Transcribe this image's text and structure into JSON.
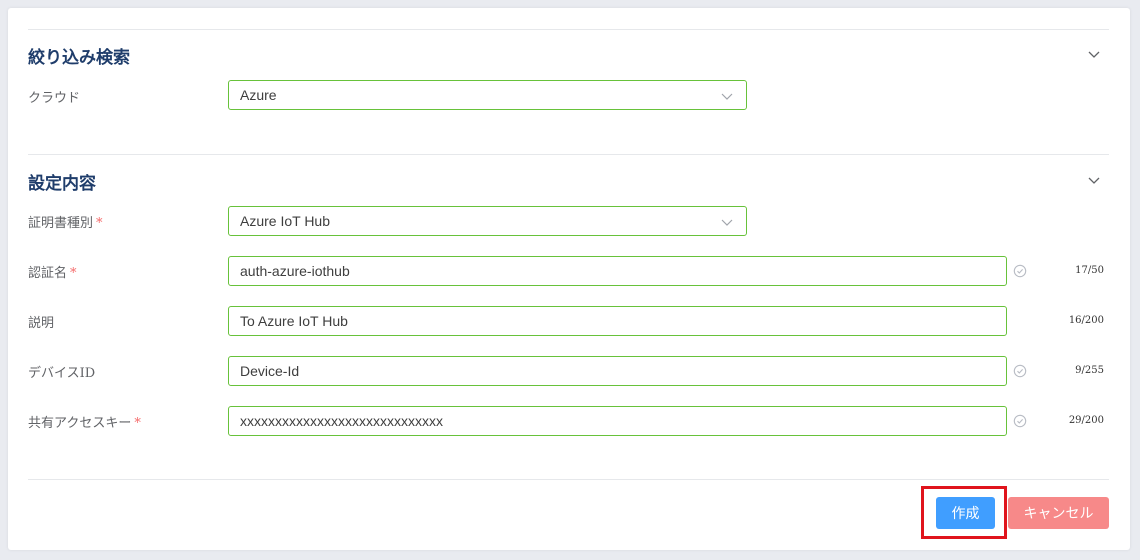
{
  "filter_section": {
    "title": "絞り込み検索",
    "cloud": {
      "label": "クラウド",
      "value": "Azure"
    }
  },
  "settings_section": {
    "title": "設定内容",
    "cert_type": {
      "label": "証明書種別",
      "required": "*",
      "value": "Azure IoT Hub"
    },
    "auth_name": {
      "label": "認証名",
      "required": "*",
      "value": "auth-azure-iothub",
      "count": "17/50"
    },
    "description": {
      "label": "説明",
      "value": "To Azure IoT Hub",
      "count": "16/200"
    },
    "device_id": {
      "label": "デバイスID",
      "value": "Device-Id",
      "count": "9/255"
    },
    "access_key": {
      "label": "共有アクセスキー",
      "required": "*",
      "value": "xxxxxxxxxxxxxxxxxxxxxxxxxxxxx",
      "count": "29/200"
    }
  },
  "footer": {
    "create_label": "作成",
    "cancel_label": "キャンセル"
  },
  "colors": {
    "accent": "#409eff",
    "danger": "#f78989",
    "valid_border": "#67c23a",
    "required": "#f56c6c",
    "highlight": "#e0141c"
  }
}
